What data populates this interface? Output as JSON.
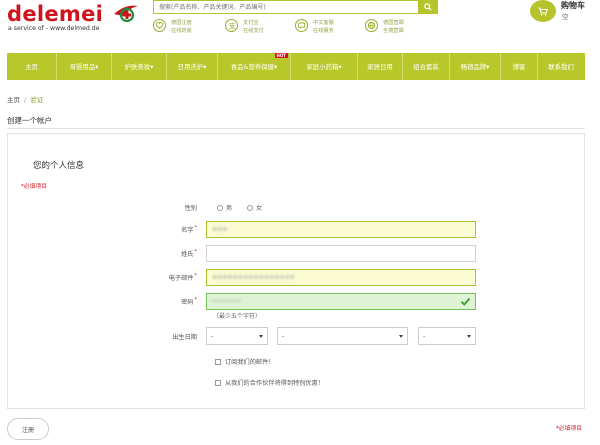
{
  "brand": {
    "logo_text": "delemei",
    "tagline": "a service of - www.delmed.de",
    "brand_color": "#d0141e",
    "accent_color": "#b8c82a"
  },
  "search": {
    "placeholder": "搜索(产品名称、产品关键词、产品编号)",
    "icon": "search-icon"
  },
  "features": [
    {
      "icon": "heart-icon",
      "line1": "德国注册",
      "line2": "在线药房"
    },
    {
      "icon": "payment-icon",
      "line1": "支付宝",
      "line2": "在线支付"
    },
    {
      "icon": "chat-icon",
      "line1": "中文客服",
      "line2": "在线服务"
    },
    {
      "icon": "globe-icon",
      "line1": "德国直邮",
      "line2": "全境直邮"
    }
  ],
  "cart": {
    "title": "购物车",
    "status": "空",
    "icon": "cart-icon"
  },
  "nav": {
    "items": [
      {
        "label": "主页"
      },
      {
        "label": "母婴用品▾"
      },
      {
        "label": "护肤美妆▾"
      },
      {
        "label": "日用洗护▾"
      },
      {
        "label": "食品&营养保健▾",
        "badge": "HOT"
      },
      {
        "label": "家庭小药箱▾"
      },
      {
        "label": "家居日用"
      },
      {
        "label": "组合套装"
      },
      {
        "label": "畅销品牌▾"
      },
      {
        "label": "博客"
      },
      {
        "label": "联系我们"
      }
    ]
  },
  "breadcrumb": {
    "home": "主页",
    "separator": "/",
    "current": "验证"
  },
  "page_title": "创建一个帐户",
  "form": {
    "section_title": "您的个人信息",
    "required_note": "*必填项目",
    "gender": {
      "label": "性别",
      "options": [
        "男",
        "女"
      ]
    },
    "first_name": {
      "label": "名字",
      "value": "※※※"
    },
    "last_name": {
      "label": "姓氏",
      "value": ""
    },
    "email": {
      "label": "电子邮件",
      "value": "※※※※※※※※※※※※※※※※"
    },
    "password": {
      "label": "密码",
      "value": "••••••••",
      "hint": "（最少五个字符）"
    },
    "dob": {
      "label": "出生日期",
      "day": "-",
      "month": "-",
      "year": "-"
    },
    "newsletter": "订阅我们的邮件！",
    "offers": "从我们的合作伙伴将得到特别优惠！",
    "submit": "注册",
    "required_note_bottom": "*必填项目"
  }
}
